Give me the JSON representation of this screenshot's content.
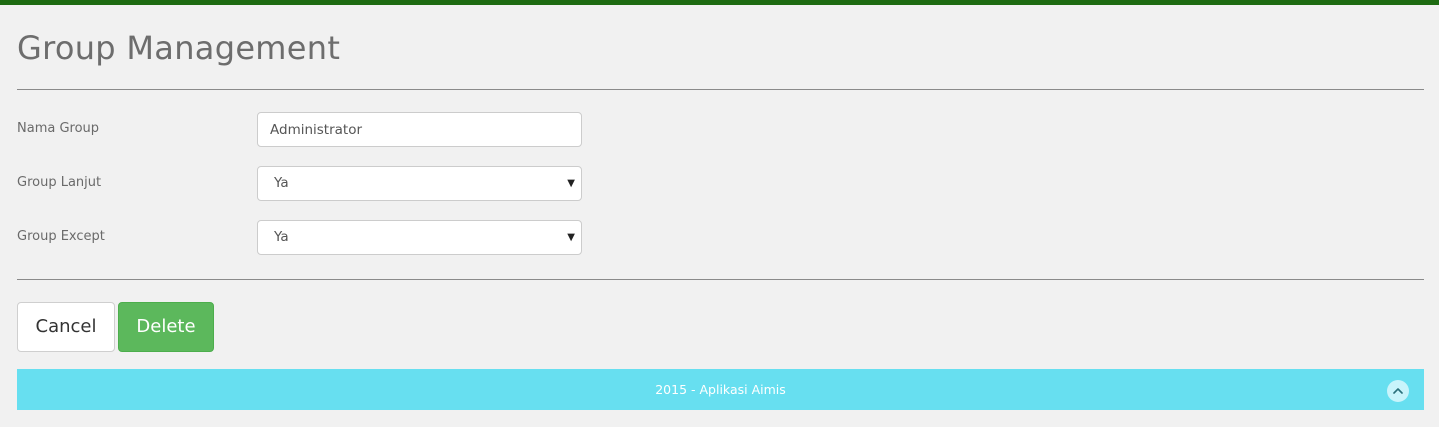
{
  "page": {
    "title": "Group Management"
  },
  "form": {
    "fields": [
      {
        "label": "Nama Group",
        "value": "Administrator",
        "type": "text"
      },
      {
        "label": "Group Lanjut",
        "value": "Ya",
        "type": "select"
      },
      {
        "label": "Group Except",
        "value": "Ya",
        "type": "select"
      }
    ]
  },
  "actions": {
    "cancel_label": "Cancel",
    "delete_label": "Delete"
  },
  "footer": {
    "text": "2015 - Aplikasi Aimis",
    "scroll_top_icon": "chevron-up-icon"
  },
  "colors": {
    "top_bar": "#1e6b12",
    "delete_button": "#5cb85c",
    "footer": "#67dff0"
  },
  "icons": {
    "select_arrow": "caret-down-icon"
  }
}
